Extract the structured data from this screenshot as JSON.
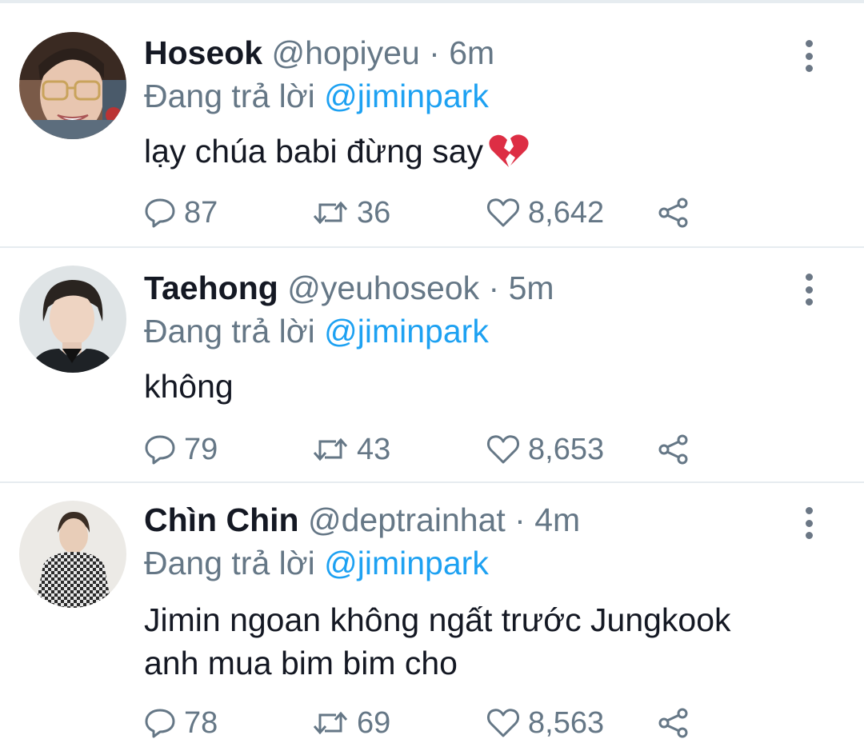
{
  "tweets": [
    {
      "name": "Hoseok",
      "handle": "@hopiyeu",
      "time": "6m",
      "reply_prefix": "Đang trả lời",
      "reply_to": "@jiminpark",
      "text": "lạy chúa babi đừng say",
      "emoji": "broken-heart",
      "replies": "87",
      "retweets": "36",
      "likes": "8,642"
    },
    {
      "name": "Taehong",
      "handle": "@yeuhoseok",
      "time": "5m",
      "reply_prefix": "Đang trả lời",
      "reply_to": "@jiminpark",
      "text": "không",
      "replies": "79",
      "retweets": "43",
      "likes": "8,653"
    },
    {
      "name": "Chìn Chin",
      "handle": "@deptrainhat",
      "time": "4m",
      "reply_prefix": "Đang trả lời",
      "reply_to": "@jiminpark",
      "text_line1": "Jimin ngoan không ngất trước Jungkook",
      "text_line2": "anh mua bim bim cho",
      "replies": "78",
      "retweets": "69",
      "likes": "8,563"
    }
  ],
  "separator": "·",
  "colors": {
    "name": "#141823",
    "secondary": "#657786",
    "link": "#1da1f2",
    "divider": "#e6ecf0"
  },
  "icons": [
    "reply-icon",
    "retweet-icon",
    "like-icon",
    "share-icon",
    "more-menu-icon"
  ]
}
